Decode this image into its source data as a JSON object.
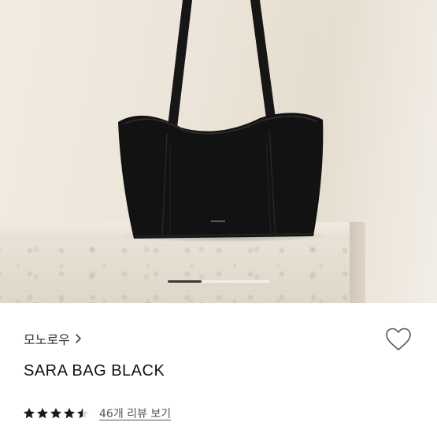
{
  "product": {
    "brand": "모노로우",
    "name": "SARA BAG BLACK",
    "rating": 4.5,
    "rating_max": 5,
    "review_link_text": "46개 리뷰 보기"
  },
  "carousel": {
    "active_fraction": 0.33
  },
  "icons": {
    "brand_chevron": "chevron-right-icon",
    "wishlist": "heart-outline-icon",
    "rating": "star-icon"
  },
  "colors": {
    "bag": "#121212",
    "stars": "#1a1a1a",
    "text_primary": "#111111",
    "text_secondary": "#555555"
  }
}
